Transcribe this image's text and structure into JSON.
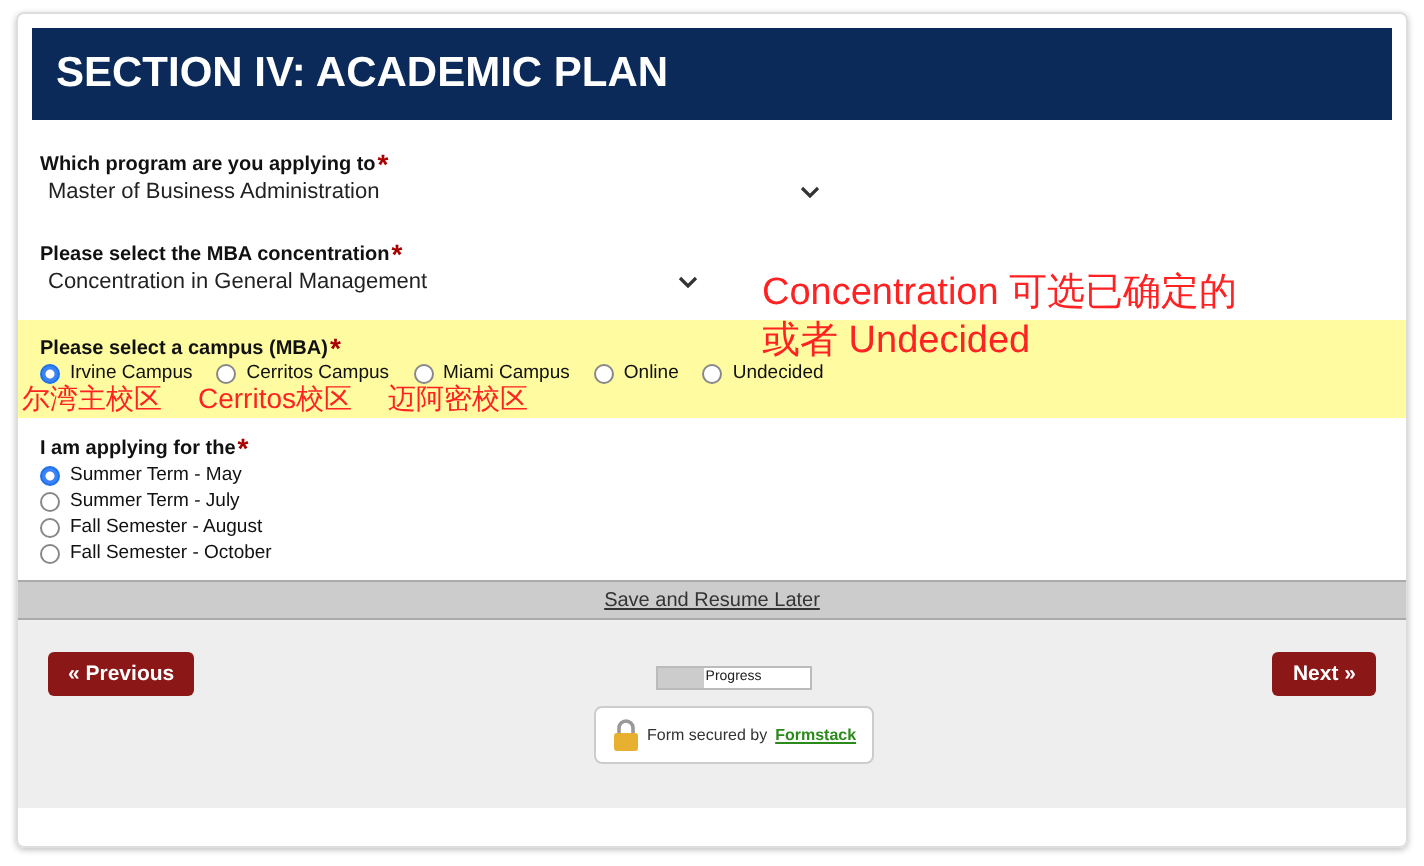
{
  "header": {
    "title": "SECTION IV: ACADEMIC PLAN"
  },
  "selects": [
    {
      "label": "Which program are you applying to",
      "required_mark": "*",
      "value": "Master of Business Administration"
    },
    {
      "label": "Please select the MBA concentration",
      "required_mark": "*",
      "value": "Concentration in General Management"
    }
  ],
  "campus": {
    "label": "Please select a campus (MBA)",
    "required_mark": "*",
    "highlighted": true,
    "options": [
      {
        "label": "Irvine Campus",
        "selected": true
      },
      {
        "label": "Cerritos Campus",
        "selected": false
      },
      {
        "label": "Miami Campus",
        "selected": false
      },
      {
        "label": "Online",
        "selected": false
      },
      {
        "label": "Undecided",
        "selected": false
      }
    ]
  },
  "term": {
    "label": "I am applying for the",
    "required_mark": "*",
    "options": [
      {
        "label": "Summer Term - May",
        "selected": true
      },
      {
        "label": "Summer Term - July",
        "selected": false
      },
      {
        "label": "Fall Semester - August",
        "selected": false
      },
      {
        "label": "Fall Semester - October",
        "selected": false
      }
    ]
  },
  "annotations": {
    "note_lines": [
      "Concentration 可选已确定的",
      "或者 Undecided"
    ],
    "campus_notes": [
      "尔湾主校区",
      "Cerritos校区",
      "迈阿密校区"
    ]
  },
  "save_link": "Save and Resume Later",
  "nav": {
    "previous": "« Previous",
    "next": "Next »"
  },
  "progress": {
    "label": "Progress",
    "level": 0.3
  },
  "secured": {
    "text": "Form secured by",
    "link": "Formstack"
  }
}
